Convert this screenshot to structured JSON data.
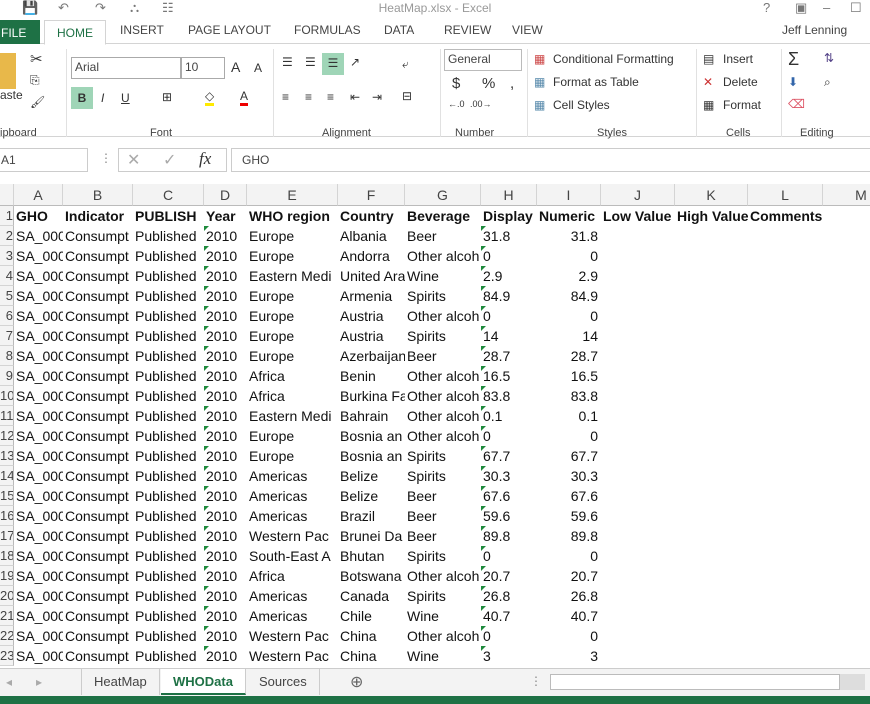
{
  "window": {
    "title": "HeatMap.xlsx - Excel"
  },
  "ribbon_tabs": [
    "FILE",
    "HOME",
    "INSERT",
    "PAGE LAYOUT",
    "FORMULAS",
    "DATA",
    "REVIEW",
    "VIEW"
  ],
  "user": "Jeff Lenning",
  "ribbon": {
    "paste": "aste",
    "clipboard": "ipboard",
    "font_name": "Arial",
    "font_size": "10",
    "font_group": "Font",
    "alignment_group": "Alignment",
    "number_format": "General",
    "number_group": "Number",
    "conditional_formatting": "Conditional Formatting",
    "format_as_table": "Format as Table",
    "cell_styles": "Cell Styles",
    "styles_group": "Styles",
    "insert": "Insert",
    "delete": "Delete",
    "format": "Format",
    "cells_group": "Cells",
    "editing_group": "Editing"
  },
  "formula_bar": {
    "name_box": "A1",
    "formula": "GHO"
  },
  "columns": [
    "A",
    "B",
    "C",
    "D",
    "E",
    "F",
    "G",
    "H",
    "I",
    "J",
    "K",
    "L",
    "M"
  ],
  "header_row": [
    "GHO",
    "Indicator",
    "PUBLISH",
    "Year",
    "WHO region",
    "Country",
    "Beverage",
    "Display",
    "Numeric",
    "Low Value",
    "High Value",
    "Comments"
  ],
  "rows": [
    [
      "SA_000",
      "Consumpt",
      "Published",
      "2010",
      "Europe",
      "Albania",
      "Beer",
      "31.8",
      "31.8"
    ],
    [
      "SA_000",
      "Consumpt",
      "Published",
      "2010",
      "Europe",
      "Andorra",
      "Other alcoh",
      "0",
      "0"
    ],
    [
      "SA_000",
      "Consumpt",
      "Published",
      "2010",
      "Eastern Medi",
      "United Ara",
      "Wine",
      "2.9",
      "2.9"
    ],
    [
      "SA_000",
      "Consumpt",
      "Published",
      "2010",
      "Europe",
      "Armenia",
      "Spirits",
      "84.9",
      "84.9"
    ],
    [
      "SA_000",
      "Consumpt",
      "Published",
      "2010",
      "Europe",
      "Austria",
      "Other alcoh",
      "0",
      "0"
    ],
    [
      "SA_000",
      "Consumpt",
      "Published",
      "2010",
      "Europe",
      "Austria",
      "Spirits",
      "14",
      "14"
    ],
    [
      "SA_000",
      "Consumpt",
      "Published",
      "2010",
      "Europe",
      "Azerbaijan",
      "Beer",
      "28.7",
      "28.7"
    ],
    [
      "SA_000",
      "Consumpt",
      "Published",
      "2010",
      "Africa",
      "Benin",
      "Other alcoh",
      "16.5",
      "16.5"
    ],
    [
      "SA_000",
      "Consumpt",
      "Published",
      "2010",
      "Africa",
      "Burkina Fa",
      "Other alcoh",
      "83.8",
      "83.8"
    ],
    [
      "SA_000",
      "Consumpt",
      "Published",
      "2010",
      "Eastern Medi",
      "Bahrain",
      "Other alcoh",
      "0.1",
      "0.1"
    ],
    [
      "SA_000",
      "Consumpt",
      "Published",
      "2010",
      "Europe",
      "Bosnia an",
      "Other alcoh",
      "0",
      "0"
    ],
    [
      "SA_000",
      "Consumpt",
      "Published",
      "2010",
      "Europe",
      "Bosnia an",
      "Spirits",
      "67.7",
      "67.7"
    ],
    [
      "SA_000",
      "Consumpt",
      "Published",
      "2010",
      "Americas",
      "Belize",
      "Spirits",
      "30.3",
      "30.3"
    ],
    [
      "SA_000",
      "Consumpt",
      "Published",
      "2010",
      "Americas",
      "Belize",
      "Beer",
      "67.6",
      "67.6"
    ],
    [
      "SA_000",
      "Consumpt",
      "Published",
      "2010",
      "Americas",
      "Brazil",
      "Beer",
      "59.6",
      "59.6"
    ],
    [
      "SA_000",
      "Consumpt",
      "Published",
      "2010",
      "Western Pac",
      "Brunei Da",
      "Beer",
      "89.8",
      "89.8"
    ],
    [
      "SA_000",
      "Consumpt",
      "Published",
      "2010",
      "South-East A",
      "Bhutan",
      "Spirits",
      "0",
      "0"
    ],
    [
      "SA_000",
      "Consumpt",
      "Published",
      "2010",
      "Africa",
      "Botswana",
      "Other alcoh",
      "20.7",
      "20.7"
    ],
    [
      "SA_000",
      "Consumpt",
      "Published",
      "2010",
      "Americas",
      "Canada",
      "Spirits",
      "26.8",
      "26.8"
    ],
    [
      "SA_000",
      "Consumpt",
      "Published",
      "2010",
      "Americas",
      "Chile",
      "Wine",
      "40.7",
      "40.7"
    ],
    [
      "SA_000",
      "Consumpt",
      "Published",
      "2010",
      "Western Pac",
      "China",
      "Other alcoh",
      "0",
      "0"
    ],
    [
      "SA_000",
      "Consumpt",
      "Published",
      "2010",
      "Western Pac",
      "China",
      "Wine",
      "3",
      "3"
    ]
  ],
  "row_numbers": [
    "1",
    "2",
    "3",
    "4",
    "5",
    "6",
    "7",
    "8",
    "9",
    "10",
    "11",
    "12",
    "13",
    "14",
    "15",
    "16",
    "17",
    "18",
    "19",
    "20",
    "21",
    "22",
    "23"
  ],
  "sheets": [
    {
      "label": "HeatMap",
      "active": false
    },
    {
      "label": "WHOData",
      "active": true
    },
    {
      "label": "Sources",
      "active": false
    }
  ],
  "colors": {
    "accent": "#1e7145",
    "selected_button": "#9fd5b7"
  }
}
